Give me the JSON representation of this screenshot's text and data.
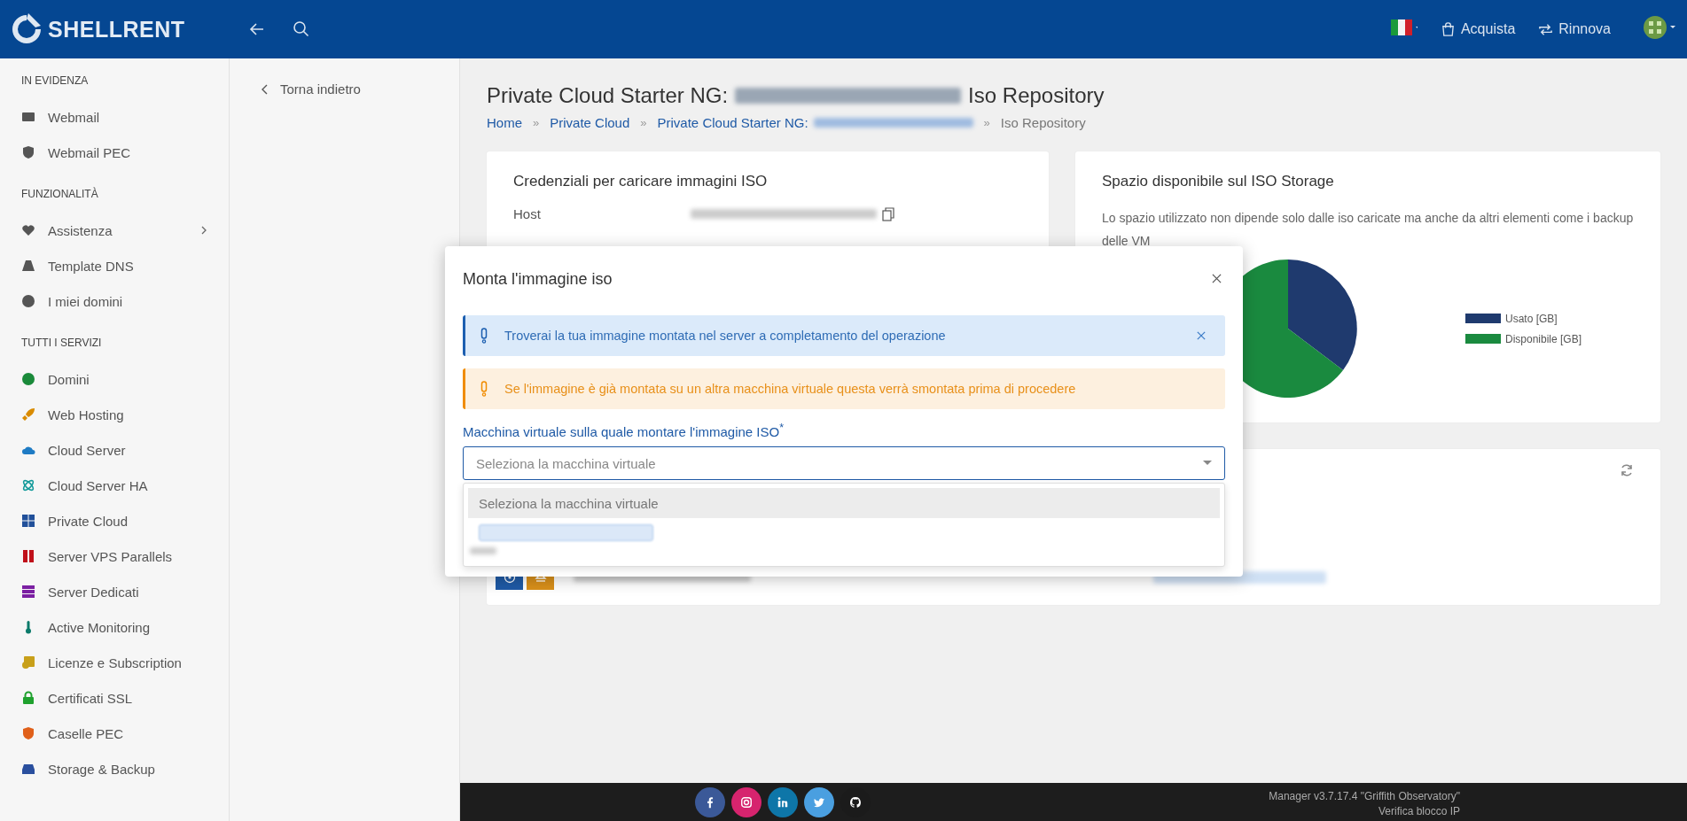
{
  "header": {
    "brand": "SHELLRENT",
    "actions": [
      {
        "kind": "cart",
        "label": "Acquista"
      },
      {
        "kind": "renew",
        "label": "Rinnova"
      }
    ]
  },
  "sidebar": {
    "sections": [
      {
        "title": "IN EVIDENZA",
        "items": [
          {
            "label": "Webmail",
            "kind": "envelope",
            "color": "#555555",
            "expandable": false
          },
          {
            "label": "Webmail PEC",
            "kind": "shield",
            "color": "#555555",
            "expandable": false
          }
        ]
      },
      {
        "title": "FUNZIONALITÀ",
        "items": [
          {
            "label": "Assistenza",
            "kind": "heart",
            "color": "#555555",
            "expandable": true
          },
          {
            "label": "Template DNS",
            "kind": "road",
            "color": "#555555",
            "expandable": false
          },
          {
            "label": "I miei domini",
            "kind": "globe",
            "color": "#555555",
            "expandable": false
          }
        ]
      },
      {
        "title": "TUTTI I SERVIZI",
        "items": [
          {
            "label": "Domini",
            "kind": "globe",
            "color": "#1a8a3a",
            "expandable": false
          },
          {
            "label": "Web Hosting",
            "kind": "rocket",
            "color": "#d98b00",
            "expandable": false
          },
          {
            "label": "Cloud Server",
            "kind": "cloud",
            "color": "#1e7bc4",
            "expandable": false
          },
          {
            "label": "Cloud Server HA",
            "kind": "atom",
            "color": "#139a9a",
            "expandable": false
          },
          {
            "label": "Private Cloud",
            "kind": "windows",
            "color": "#21509a",
            "expandable": false
          },
          {
            "label": "Server VPS Parallels",
            "kind": "bars",
            "color": "#c0101a",
            "expandable": false
          },
          {
            "label": "Server Dedicati",
            "kind": "server",
            "color": "#7b1fa2",
            "expandable": false
          },
          {
            "label": "Active Monitoring",
            "kind": "thermometer",
            "color": "#0b7a6a",
            "expandable": false
          },
          {
            "label": "Licenze e Subscription",
            "kind": "license",
            "color": "#c8a01a",
            "expandable": false
          },
          {
            "label": "Certificati SSL",
            "kind": "lock",
            "color": "#1fa12e",
            "expandable": false
          },
          {
            "label": "Caselle PEC",
            "kind": "shield",
            "color": "#e0601a",
            "expandable": false
          },
          {
            "label": "Storage & Backup",
            "kind": "hdd",
            "color": "#2a4f9e",
            "expandable": false
          }
        ]
      }
    ]
  },
  "back_link": "Torna indietro",
  "page": {
    "title_prefix": "Private Cloud Starter NG:",
    "title_suffix": "Iso Repository",
    "breadcrumb": {
      "separator": "»",
      "items": [
        {
          "label": "Home",
          "link": true,
          "blurred": false
        },
        {
          "label": "Private Cloud",
          "link": true,
          "blurred": false
        },
        {
          "label": "Private Cloud Starter NG:",
          "link": true,
          "blurred": true
        },
        {
          "label": "Iso Repository",
          "link": false,
          "blurred": false
        }
      ]
    }
  },
  "credentials_card": {
    "title": "Credenziali per caricare immagini ISO",
    "rows": [
      {
        "label": "Host"
      }
    ]
  },
  "storage_card": {
    "title": "Spazio disponibile sul ISO Storage",
    "note": "Lo spazio utilizzato non dipende solo dalle iso caricate ma anche da altri elementi come i backup delle VM",
    "legend": [
      {
        "label": "Usato [GB]",
        "color": "#1f3a6e"
      },
      {
        "label": "Disponibile [GB]",
        "color": "#1a8a3f"
      }
    ]
  },
  "modal": {
    "title": "Monta l'immagine iso",
    "alerts": [
      {
        "kind": "info",
        "text": "Troverai la tua immagine montata nel server a completamento del operazione",
        "dismissible": true
      },
      {
        "kind": "warning",
        "text": "Se l'immagine è già montata su un altra macchina virtuale questa verrà smontata prima di procedere",
        "dismissible": false
      }
    ],
    "field": {
      "label": "Macchina virtuale sulla quale montare l'immagine ISO",
      "required": "*",
      "placeholder": "Seleziona la macchina virtuale"
    },
    "options": [
      {
        "kind": "placeholder",
        "label": "Seleziona la macchina virtuale",
        "selected": true
      },
      {
        "kind": "blurred",
        "selected": false
      }
    ]
  },
  "footer": {
    "social": [
      {
        "kind": "facebook",
        "color": "#3b5998"
      },
      {
        "kind": "instagram",
        "color": "#d6246e"
      },
      {
        "kind": "linkedin",
        "color": "#0e76a8"
      },
      {
        "kind": "twitter",
        "color": "#4a9fe0"
      },
      {
        "kind": "github",
        "color": "#1b1b1b"
      }
    ],
    "version": "Manager v3.7.17.4 \"Griffith Observatory\"",
    "ip_link": "Verifica blocco IP"
  }
}
